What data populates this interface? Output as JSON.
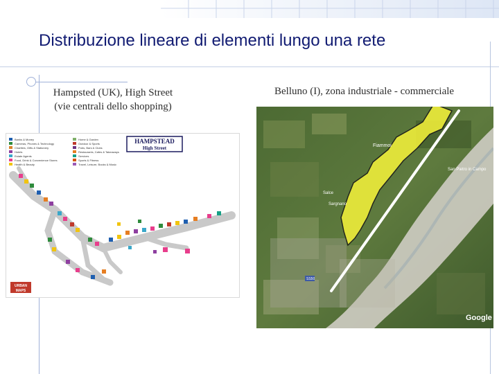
{
  "slide": {
    "title": "Distribuzione lineare di elementi lungo una rete"
  },
  "left_panel": {
    "caption_line1": "Hampsted (UK), High Street",
    "caption_line2": "(vie centrali dello shopping)",
    "logo_line1": "HAMPSTEAD",
    "logo_line2": "High Street",
    "legend_col1": [
      "Banks & Money",
      "Cameras, Phones & Technology",
      "Charities, Gifts & Stationery",
      "Hotels",
      "Estate Agents",
      "Food, Drink & Convenience Stores",
      "Health & Beauty"
    ],
    "legend_col2": [
      "Home & Garden",
      "Outdoor & Sports",
      "Pubs, Bars & Clubs",
      "Restaurants, Cafes & Takeaways",
      "Services",
      "Sports & Fitness",
      "Travel, Leisure, Books & Music"
    ],
    "legend_colors": [
      "#1f5fb0",
      "#2e8b3c",
      "#d9822b",
      "#8e3fa0",
      "#3aa7c9",
      "#e83e8c",
      "#f1c40f"
    ],
    "logo2_line1": "URBAN",
    "logo2_line2": "MAPS"
  },
  "right_panel": {
    "caption": "Belluno (I), zona industriale - commerciale",
    "place_labels": [
      "Fiammoi",
      "San Pietro in Campo",
      "Salce",
      "Sargnano",
      "SS50",
      "Google"
    ],
    "highlight_color": "#f2f03a",
    "line_color": "#ffffff"
  }
}
